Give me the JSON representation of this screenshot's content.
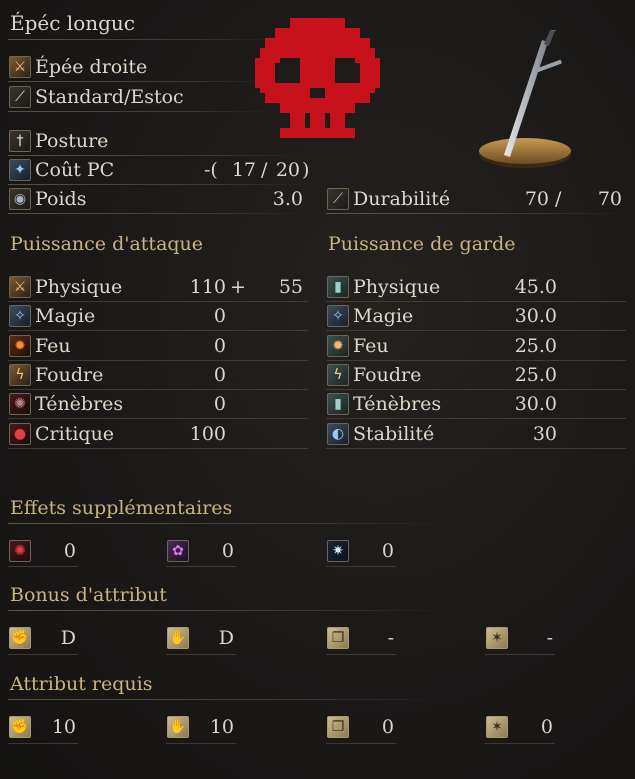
{
  "header": {
    "weapon_name": "Épéc longuc",
    "weapon_type": "Épée droite",
    "attack_type": "Standard/Estoc"
  },
  "info": {
    "skill_label": "Posture",
    "fp_label": "Coût PC",
    "fp_prefix": "-(",
    "fp_current": "17",
    "fp_sep": "/",
    "fp_max": "20",
    "fp_suffix": ")",
    "weight_label": "Poids",
    "weight_value": "3.0",
    "durability_label": "Durabilité",
    "durability_current": "70",
    "durability_sep": "/",
    "durability_max": "70"
  },
  "attack": {
    "title": "Puissance d'attaque",
    "rows": [
      {
        "label": "Physique",
        "value": "110",
        "plus": "+",
        "bonus": "55",
        "icon": "physical-icon"
      },
      {
        "label": "Magie",
        "value": "0",
        "icon": "magic-icon"
      },
      {
        "label": "Feu",
        "value": "0",
        "icon": "fire-icon"
      },
      {
        "label": "Foudre",
        "value": "0",
        "icon": "lightning-icon"
      },
      {
        "label": "Ténèbres",
        "value": "0",
        "icon": "dark-icon"
      },
      {
        "label": "Critique",
        "value": "100",
        "icon": "critical-icon"
      }
    ]
  },
  "guard": {
    "title": "Puissance de garde",
    "rows": [
      {
        "label": "Physique",
        "value": "45.0",
        "icon": "physical-guard-icon"
      },
      {
        "label": "Magie",
        "value": "30.0",
        "icon": "magic-guard-icon"
      },
      {
        "label": "Feu",
        "value": "25.0",
        "icon": "fire-guard-icon"
      },
      {
        "label": "Foudre",
        "value": "25.0",
        "icon": "lightning-guard-icon"
      },
      {
        "label": "Ténèbres",
        "value": "30.0",
        "icon": "dark-guard-icon"
      },
      {
        "label": "Stabilité",
        "value": "30",
        "icon": "stability-icon"
      }
    ]
  },
  "effects": {
    "title": "Effets supplémentaires",
    "items": [
      {
        "icon": "bleed-icon",
        "value": "0"
      },
      {
        "icon": "poison-icon",
        "value": "0"
      },
      {
        "icon": "frost-icon",
        "value": "0"
      }
    ]
  },
  "scaling": {
    "title": "Bonus d'attribut",
    "items": [
      {
        "icon": "strength-icon",
        "value": "D"
      },
      {
        "icon": "dexterity-icon",
        "value": "D"
      },
      {
        "icon": "intelligence-icon",
        "value": "-"
      },
      {
        "icon": "faith-icon",
        "value": "-"
      }
    ]
  },
  "requirements": {
    "title": "Attribut requis",
    "items": [
      {
        "icon": "strength-icon",
        "value": "10"
      },
      {
        "icon": "dexterity-icon",
        "value": "10"
      },
      {
        "icon": "intelligence-icon",
        "value": "0"
      },
      {
        "icon": "faith-icon",
        "value": "0"
      }
    ]
  },
  "colors": {
    "background": "#1b1918",
    "text": "#ddd6cb",
    "section_title": "#c9b382",
    "skull": "#c8121b"
  }
}
